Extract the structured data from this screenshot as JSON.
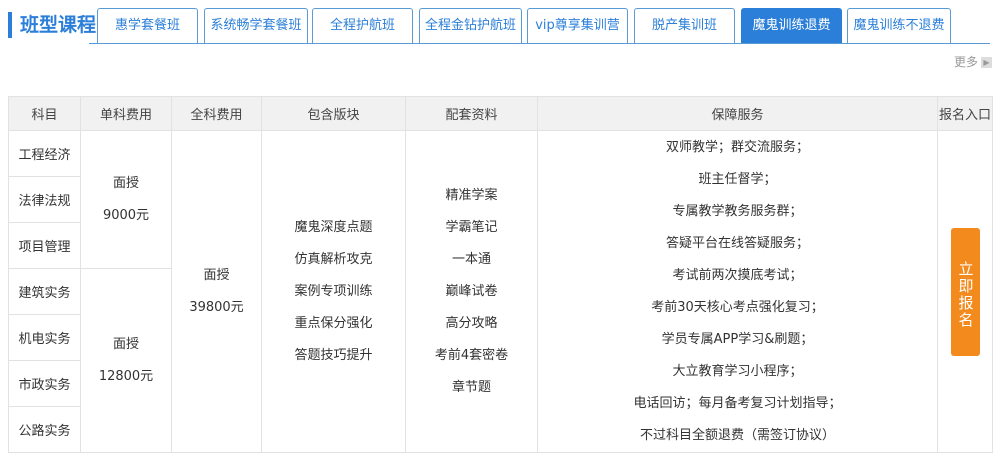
{
  "header": {
    "title": "班型课程"
  },
  "tabs": [
    {
      "label": "惠学套餐班",
      "active": false
    },
    {
      "label": "系统畅学套餐班",
      "active": false
    },
    {
      "label": "全程护航班",
      "active": false
    },
    {
      "label": "全程金钻护航班",
      "active": false
    },
    {
      "label": "vip尊享集训营",
      "active": false
    },
    {
      "label": "脱产集训班",
      "active": false
    },
    {
      "label": "魔鬼训练退费",
      "active": true
    },
    {
      "label": "魔鬼训练不退费",
      "active": false
    }
  ],
  "more": {
    "label": "更多",
    "icon": "chevron-right-icon"
  },
  "table": {
    "headers": [
      "科目",
      "单科费用",
      "全科费用",
      "包含版块",
      "配套资料",
      "保障服务",
      "报名入口"
    ],
    "subjects": [
      "工程经济",
      "法律法规",
      "项目管理",
      "建筑实务",
      "机电实务",
      "市政实务",
      "公路实务"
    ],
    "single_fee_1": {
      "mode": "面授",
      "price": "9000元"
    },
    "single_fee_2": {
      "mode": "面授",
      "price": "12800元"
    },
    "full_fee": {
      "mode": "面授",
      "price": "39800元"
    },
    "modules": [
      "魔鬼深度点题",
      "仿真解析攻克",
      "案例专项训练",
      "重点保分强化",
      "答题技巧提升"
    ],
    "materials": [
      "精准学案",
      "学霸笔记",
      "一本通",
      "巅峰试卷",
      "高分攻略",
      "考前4套密卷",
      "章节题"
    ],
    "services": [
      "双师教学；群交流服务；",
      "班主任督学；",
      "专属教学教务服务群；",
      "答疑平台在线答疑服务；",
      "考试前两次摸底考试；",
      "考前30天核心考点强化复习；",
      "学员专属APP学习&刷题；",
      "大立教育学习小程序；",
      "电话回访；每月备考复习计划指导；",
      "不过科目全额退费（需签订协议）"
    ],
    "enroll_label": "立即报名"
  },
  "colors": {
    "accent": "#2b7fd8",
    "enroll": "#f28a1e"
  }
}
